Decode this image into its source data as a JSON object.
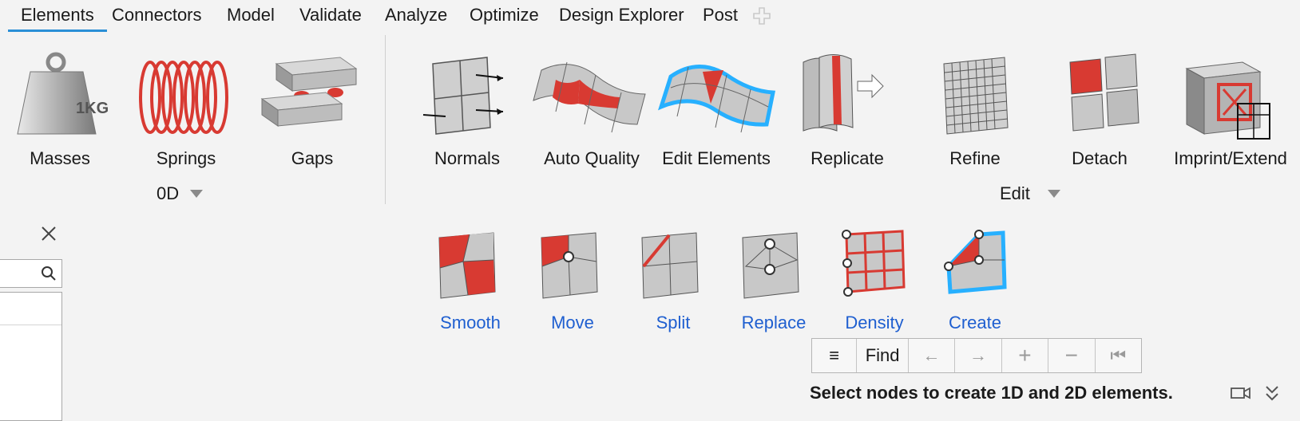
{
  "menu": {
    "tabs": [
      "Elements",
      "Connectors",
      "Model",
      "Validate",
      "Analyze",
      "Optimize",
      "Design Explorer",
      "Post"
    ],
    "active": "Elements"
  },
  "row1_left": [
    {
      "label": "Masses",
      "icon": "mass-weight-icon"
    },
    {
      "label": "Springs",
      "icon": "spring-coil-icon"
    },
    {
      "label": "Gaps",
      "icon": "gap-blocks-icon"
    }
  ],
  "row1_left_group": {
    "label": "0D"
  },
  "row1_right": [
    {
      "label": "Normals",
      "icon": "normals-icon"
    },
    {
      "label": "Auto Quality",
      "icon": "auto-quality-icon"
    },
    {
      "label": "Edit Elements",
      "icon": "edit-elements-icon"
    },
    {
      "label": "Replicate",
      "icon": "replicate-icon"
    },
    {
      "label": "Refine",
      "icon": "refine-icon"
    },
    {
      "label": "Detach",
      "icon": "detach-icon"
    },
    {
      "label": "Imprint/Extend",
      "icon": "imprint-extend-icon"
    }
  ],
  "row1_right_group": {
    "label": "Edit"
  },
  "row2": [
    {
      "label": "Smooth",
      "icon": "smooth-icon"
    },
    {
      "label": "Move",
      "icon": "move-node-icon"
    },
    {
      "label": "Split",
      "icon": "split-icon"
    },
    {
      "label": "Replace",
      "icon": "replace-icon"
    },
    {
      "label": "Density",
      "icon": "density-icon"
    },
    {
      "label": "Create",
      "icon": "create-element-icon"
    }
  ],
  "toolbar": {
    "menu_icon": "≡",
    "find_label": "Find",
    "back_icon": "←",
    "forward_icon": "→",
    "add_icon": "+",
    "remove_icon": "−",
    "first_icon": "⏮"
  },
  "status": {
    "message": "Select nodes to create 1D and 2D elements."
  },
  "colors": {
    "accent": "#2a8fd6",
    "red": "#d83a32",
    "link": "#1f5fd0",
    "glow": "#27b0ff"
  }
}
